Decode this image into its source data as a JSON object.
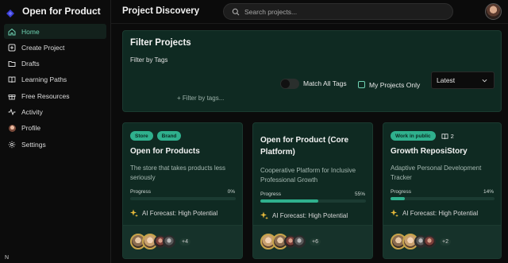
{
  "app": {
    "name": "Open for Product",
    "bottom_initial": "N"
  },
  "sidebar": {
    "items": [
      {
        "label": "Home",
        "icon": "home-icon",
        "active": true
      },
      {
        "label": "Create Project",
        "icon": "plus-square-icon"
      },
      {
        "label": "Drafts",
        "icon": "folder-icon"
      },
      {
        "label": "Learning Paths",
        "icon": "book-icon"
      },
      {
        "label": "Free Resources",
        "icon": "gift-icon"
      },
      {
        "label": "Activity",
        "icon": "activity-icon"
      },
      {
        "label": "Profile",
        "icon": "profile-avatar-icon"
      },
      {
        "label": "Settings",
        "icon": "gear-icon"
      }
    ]
  },
  "header": {
    "title": "Project Discovery",
    "search_placeholder": "Search projects..."
  },
  "filters": {
    "title": "Filter Projects",
    "subtitle": "Filter by Tags",
    "tag_placeholder": "+ Filter by tags...",
    "match_all_label": "Match All Tags",
    "my_projects_label": "My Projects Only",
    "sort_value": "Latest"
  },
  "colors": {
    "accent": "#2fb08d",
    "panel": "#0f2a22",
    "active_text": "#6fd2b3"
  },
  "cards": [
    {
      "tags": [
        "Store",
        "Brand"
      ],
      "title": "Open for Products",
      "desc": "The store that takes products less seriously",
      "progress_label": "Progress",
      "progress_text": "0%",
      "progress": 0,
      "forecast": "AI Forecast: High Potential",
      "more": "+4"
    },
    {
      "tags": [],
      "title": "Open for Product (Core Platform)",
      "desc": "Cooperative Platform for Inclusive Professional Growth",
      "progress_label": "Progress",
      "progress_text": "55%",
      "progress": 55,
      "forecast": "AI Forecast: High Potential",
      "more": "+6"
    },
    {
      "tags": [
        "Work in public"
      ],
      "doc_count": "2",
      "title": "Growth ReposiStory",
      "desc": "Adaptive Personal Development Tracker",
      "progress_label": "Progress",
      "progress_text": "14%",
      "progress": 14,
      "forecast": "AI Forecast: High Potential",
      "more": "+2"
    }
  ]
}
